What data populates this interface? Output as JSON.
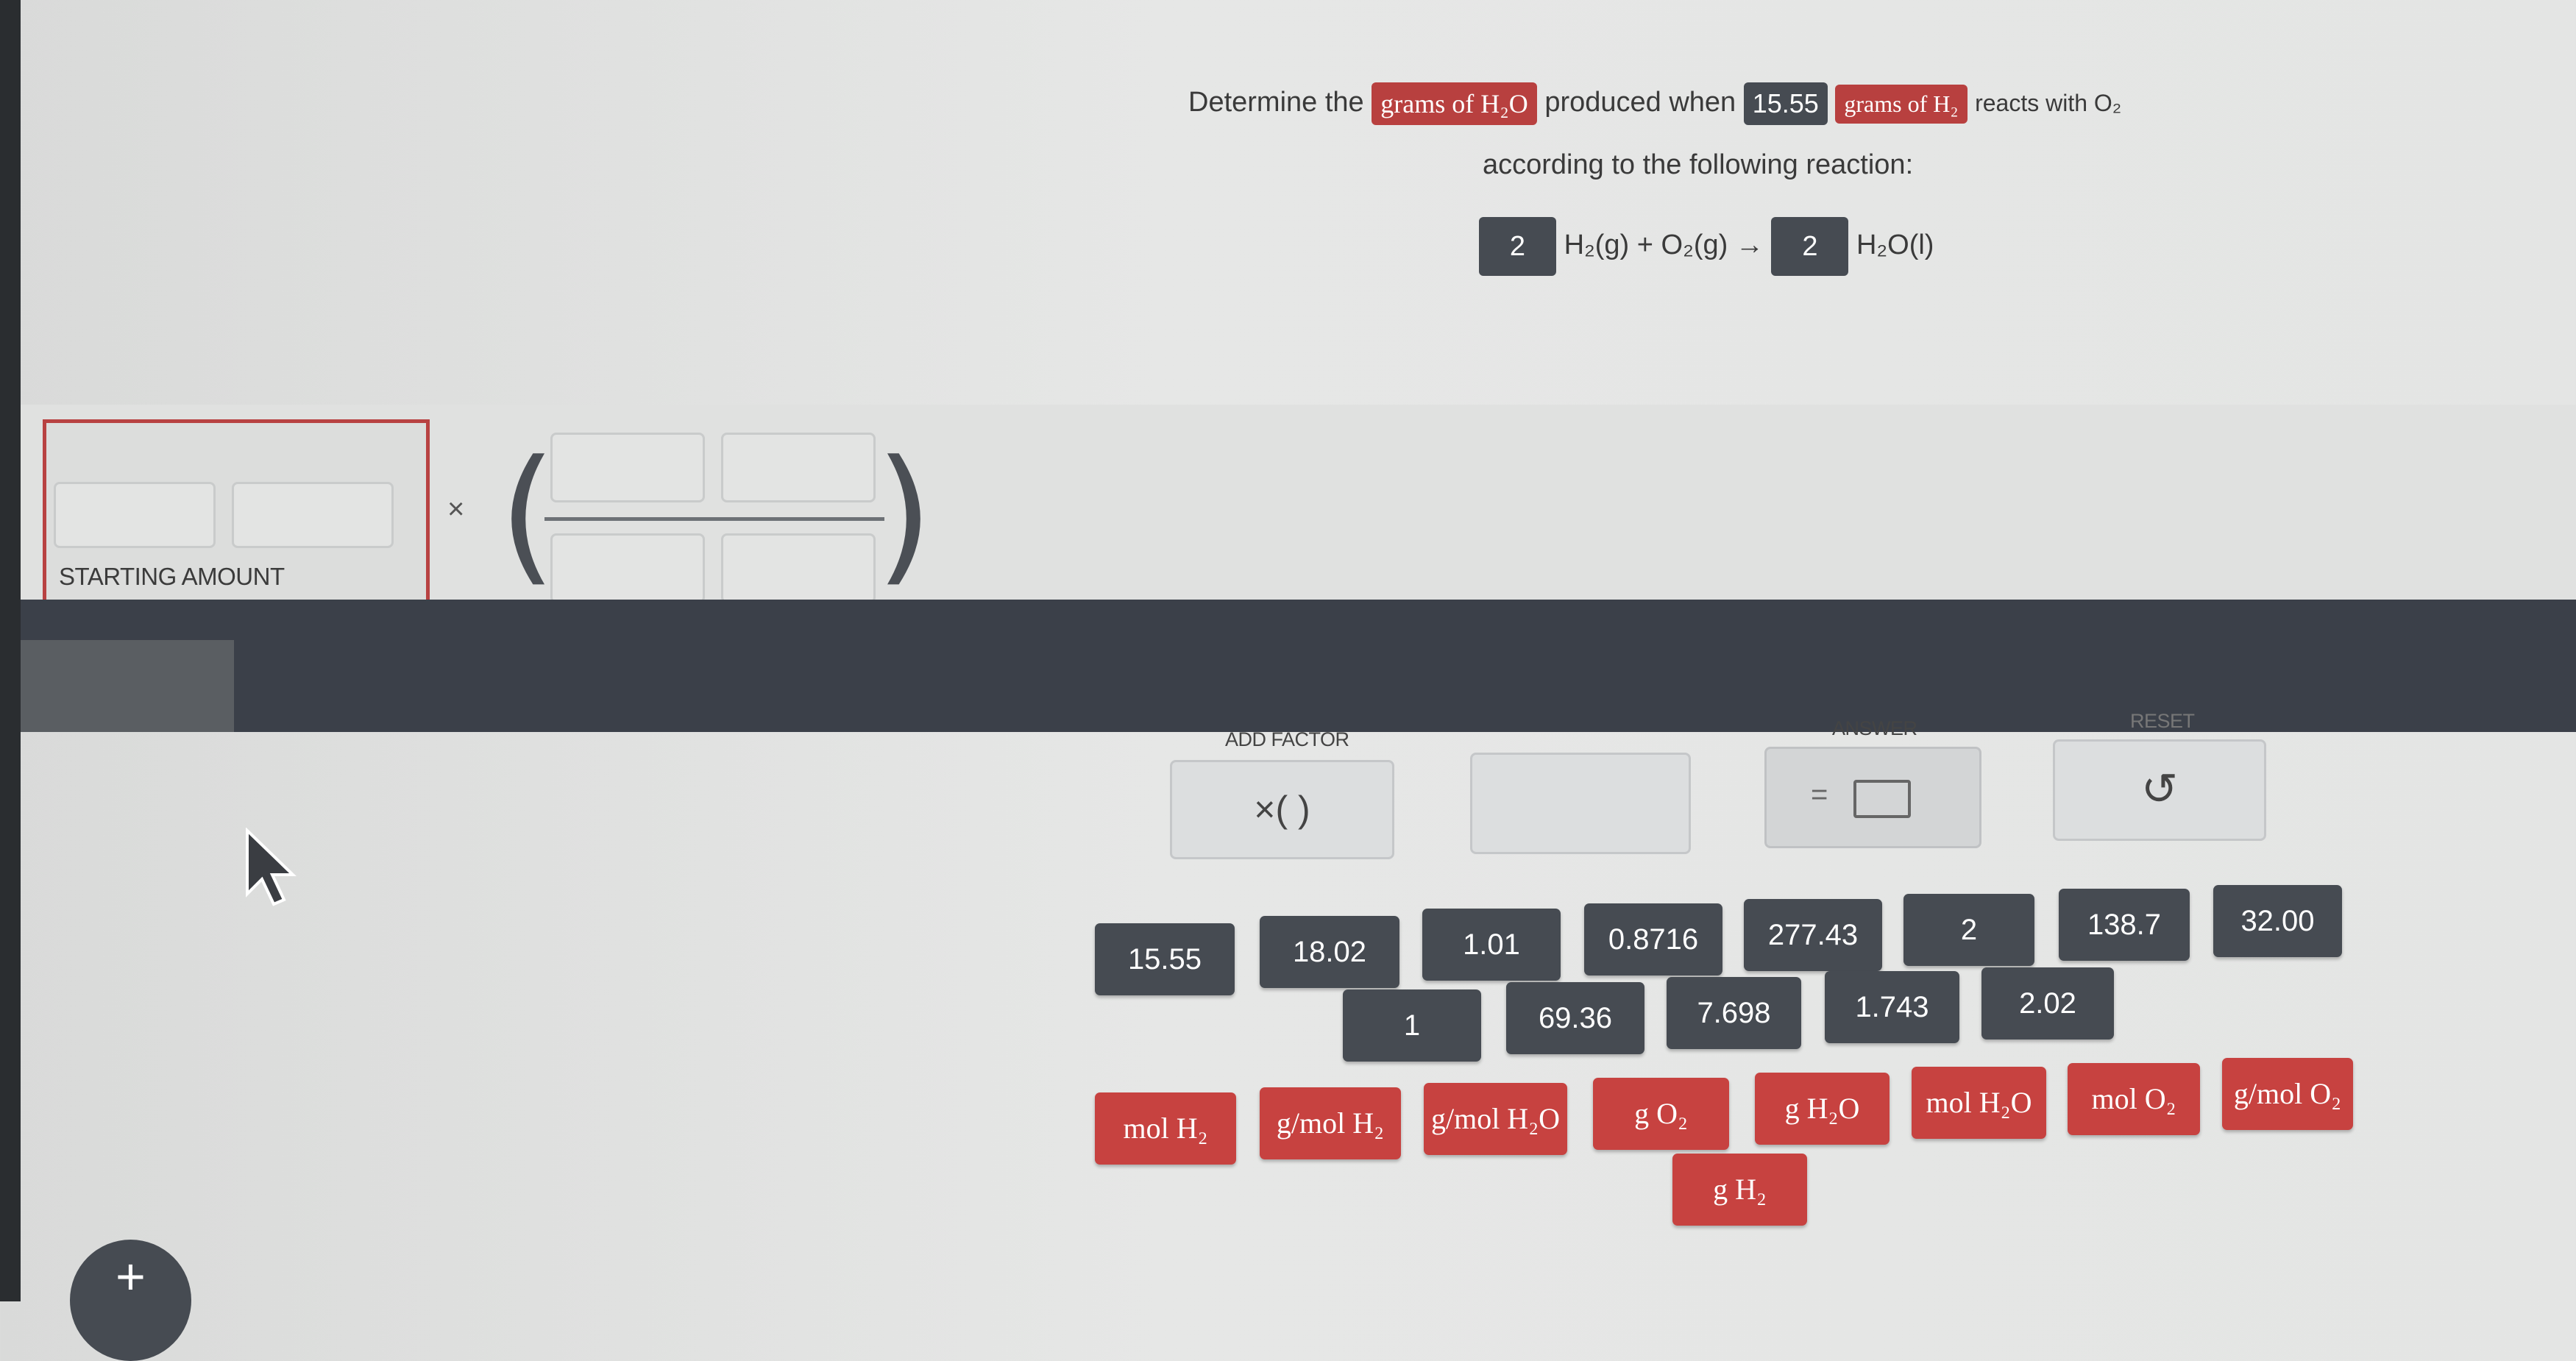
{
  "question": {
    "determine_the": "Determine the",
    "target": "grams of H₂O",
    "produced_when": "produced when",
    "given_value": "15.55",
    "given_unit": "grams of H₂",
    "reacts_with": "reacts with O₂",
    "line2": "according to the following reaction:",
    "coef1": "2",
    "reactants": "H₂(g) + O₂(g) →",
    "coef2": "2",
    "product": "H₂O(l)"
  },
  "work": {
    "starting_amount_label": "STARTING AMOUNT",
    "times_symbol": "×"
  },
  "controls": {
    "add_factor_label": "ADD FACTOR",
    "add_factor_button": "×( )",
    "answer_label": "ANSWER",
    "answer_equals": "=",
    "reset_label": "RESET",
    "reset_icon": "↺"
  },
  "number_tiles_row1": [
    "15.55",
    "18.02",
    "1.01",
    "0.8716",
    "277.43",
    "2",
    "138.7",
    "32.00"
  ],
  "number_tiles_row2": [
    "1",
    "69.36",
    "7.698",
    "1.743",
    "2.02"
  ],
  "unit_tiles_row1": [
    "mol H₂",
    "g/mol H₂",
    "g/mol H₂O",
    "g O₂",
    "g H₂O",
    "mol H₂O",
    "mol O₂",
    "g/mol O₂"
  ],
  "unit_tiles_row2": [
    "g H₂"
  ],
  "bottom": {
    "add_icon": "+"
  },
  "colors": {
    "unit_tile": "#c74240",
    "number_tile": "#464b52",
    "starting_border": "#b84242"
  }
}
